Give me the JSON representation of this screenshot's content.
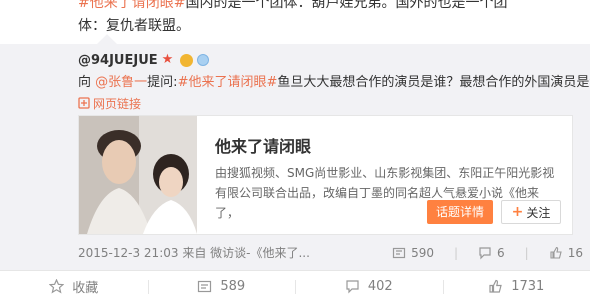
{
  "top": {
    "hashtag": "#他来了请闭眼#",
    "text": "国内的是一个团体：葫芦娃兄弟。国外的也是一个团体：复仇者联盟。"
  },
  "repost": {
    "username": "@94JUEJUE",
    "question": {
      "prefix": "向",
      "mention": "@张鲁一",
      "asked": "提问:",
      "hashtag": "#他来了请闭眼#",
      "text": "鱼旦大大最想合作的演员是谁？最想合作的外国演员是谁？"
    },
    "page_link": "网页链接",
    "card": {
      "title": "他来了请闭眼",
      "description": "由搜狐视频、SMG尚世影业、山东影视集团、东阳正午阳光影视有限公司联合出品，改编自丁墨的同名超人气悬爱小说《他来了，",
      "detail_button": "话题详情",
      "follow_button": "关注"
    },
    "meta": {
      "time": "2015-12-3 21:03",
      "source": "来自 微访谈-《他来了...",
      "reposts": "590",
      "comments": "6",
      "likes": "16"
    }
  },
  "actions": {
    "favorite": "收藏",
    "repost": "589",
    "comment": "402",
    "like": "1731"
  },
  "colors": {
    "accent": "#eb7350",
    "button": "#ff8140",
    "card_bg": "#f2f2f5"
  }
}
